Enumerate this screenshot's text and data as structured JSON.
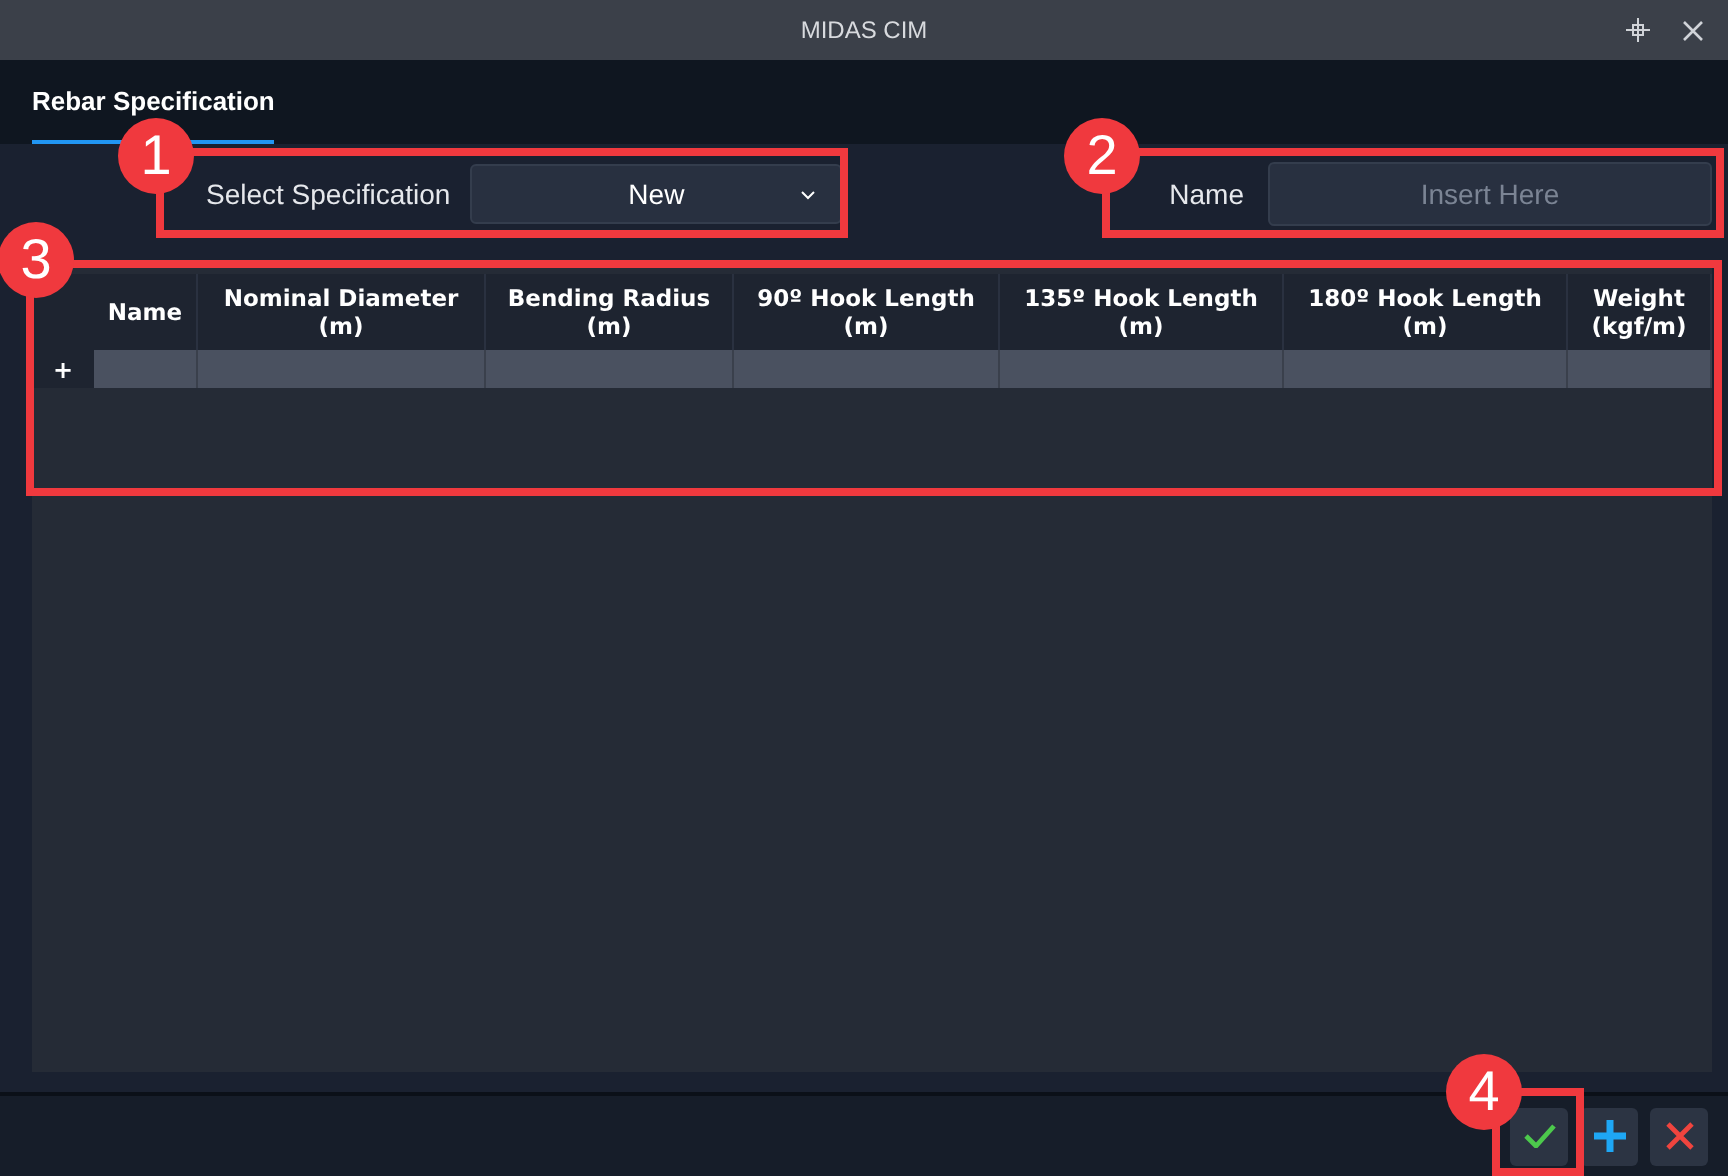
{
  "window": {
    "title": "MIDAS CIM"
  },
  "tabs": [
    {
      "label": "Rebar Specification",
      "selected": true
    }
  ],
  "specification": {
    "label": "Select Specification",
    "value": "New"
  },
  "name_field": {
    "label": "Name",
    "placeholder": "Insert Here"
  },
  "table": {
    "columns": [
      [
        "Name"
      ],
      [
        "Nominal Diameter",
        "(m)"
      ],
      [
        "Bending Radius",
        "(m)"
      ],
      [
        "90º Hook Length",
        "(m)"
      ],
      [
        "135º Hook Length",
        "(m)"
      ],
      [
        "180º Hook Length",
        "(m)"
      ],
      [
        "Weight",
        "(kgf/m)"
      ]
    ],
    "new_row_marker": "+"
  },
  "footer_buttons": [
    {
      "kind": "confirm"
    },
    {
      "kind": "add"
    },
    {
      "kind": "cancel"
    }
  ],
  "callouts": [
    {
      "number": "1"
    },
    {
      "number": "2"
    },
    {
      "number": "3"
    },
    {
      "number": "4"
    }
  ]
}
